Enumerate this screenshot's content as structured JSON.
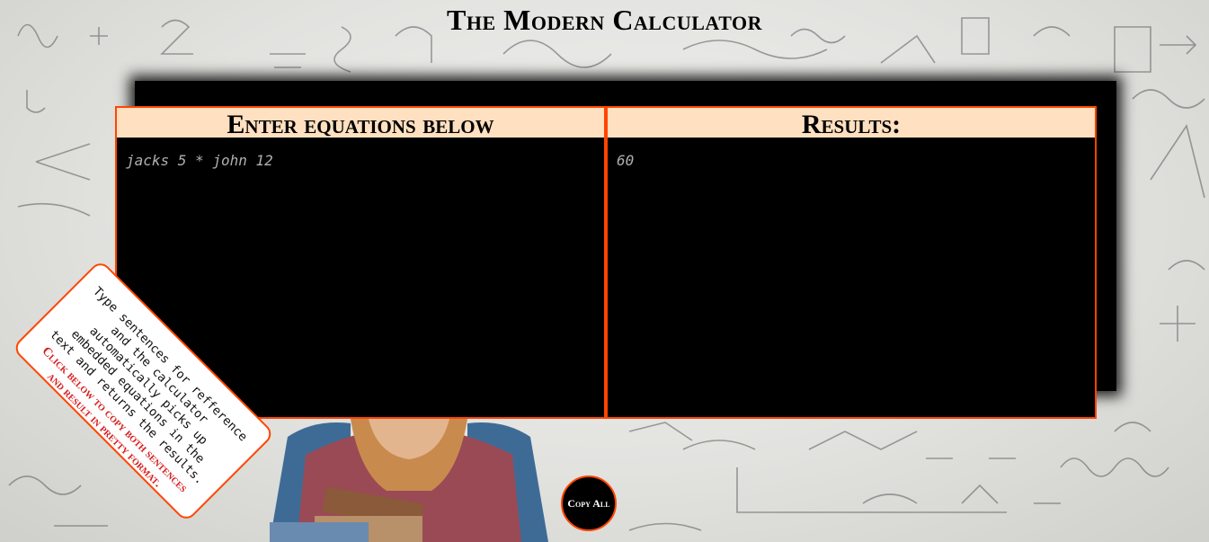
{
  "page": {
    "title": "The Modern Calculator"
  },
  "input_panel": {
    "header": "Enter equations below",
    "content": "jacks 5 * john 12"
  },
  "results_panel": {
    "header": "Results:",
    "content": "60"
  },
  "help_note": {
    "text": "Type sentences for refference and the calculator automatically picks up embedded equations in the text and returns the results.",
    "copy_hint": "Click below to copy both sentences and result in pretty format."
  },
  "copy_button": {
    "label": "Copy All"
  },
  "colors": {
    "accent": "#ff4500",
    "panel_header": "#ffe0c0",
    "panel_bg": "#000000",
    "hint_text": "#d61a1a"
  }
}
